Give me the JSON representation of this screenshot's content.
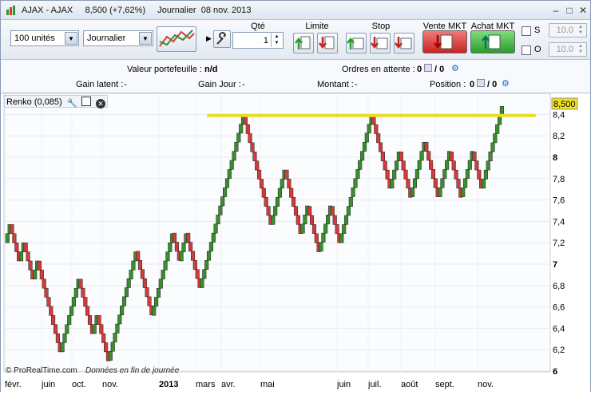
{
  "window": {
    "title": "AJAX - AJAX",
    "price_info": "8,500 (+7,62%)",
    "period_info": "Journalier  08 nov. 2013"
  },
  "toolbar": {
    "quantity_select": "100 unités",
    "timeframe_select": "Journalier",
    "qty_label": "Qté",
    "qty_value": "1",
    "limit_label": "Limite",
    "stop_label": "Stop",
    "sell_label": "Vente MKT",
    "buy_label": "Achat MKT",
    "s_label": "S",
    "o_label": "O",
    "s_value": "10.0",
    "o_value": "10.0"
  },
  "info": {
    "portfolio_label": "Valeur portefeuille :",
    "portfolio_value": "n/d",
    "pending_label": "Ordres en attente :",
    "pending_a": "0",
    "pending_b": "/ 0",
    "latent_label": "Gain latent :",
    "latent_value": "-",
    "day_label": "Gain Jour :",
    "day_value": "-",
    "amount_label": "Montant :",
    "amount_value": "-",
    "position_label": "Position :",
    "position_a": "0",
    "position_b": "/ 0"
  },
  "indicator": {
    "label": "Renko (0,085)"
  },
  "chart_data": {
    "type": "renko",
    "brick_size": 0.085,
    "last_price": "8,500",
    "ylim": [
      6.0,
      8.55
    ],
    "yticks": [
      "6",
      "6,2",
      "6,4",
      "6,6",
      "6,8",
      "7",
      "7,2",
      "7,4",
      "7,6",
      "7,8",
      "8",
      "8,2",
      "8,4"
    ],
    "xticks": [
      "févr.",
      "juin",
      "oct.",
      "nov.",
      "2013",
      "mars",
      "avr.",
      "mai",
      "juin",
      "juil.",
      "août",
      "sept.",
      "nov."
    ],
    "resistance_level": 8.39,
    "path": [
      7.2,
      7.37,
      7.2,
      7.03,
      7.2,
      7.03,
      6.86,
      7.03,
      6.86,
      6.52,
      6.18,
      6.52,
      6.86,
      6.52,
      6.35,
      6.52,
      6.35,
      6.1,
      6.44,
      6.86,
      7.12,
      6.52,
      6.86,
      7.29,
      7.03,
      7.29,
      6.78,
      7.29,
      8.39,
      7.37,
      7.88,
      7.29,
      7.54,
      7.12,
      7.54,
      7.2,
      7.63,
      8.39,
      7.71,
      8.05,
      7.63,
      8.14,
      7.63,
      8.05,
      7.63,
      8.05,
      7.71,
      8.5
    ],
    "footer_brand": "© ProRealTime.com",
    "footer_note": "Données en fin de journée",
    "colors": {
      "up": "#3a8e2d",
      "down": "#d23b3b",
      "resistance": "#e8dc2a",
      "last_price_badge": "#f0e020"
    }
  }
}
